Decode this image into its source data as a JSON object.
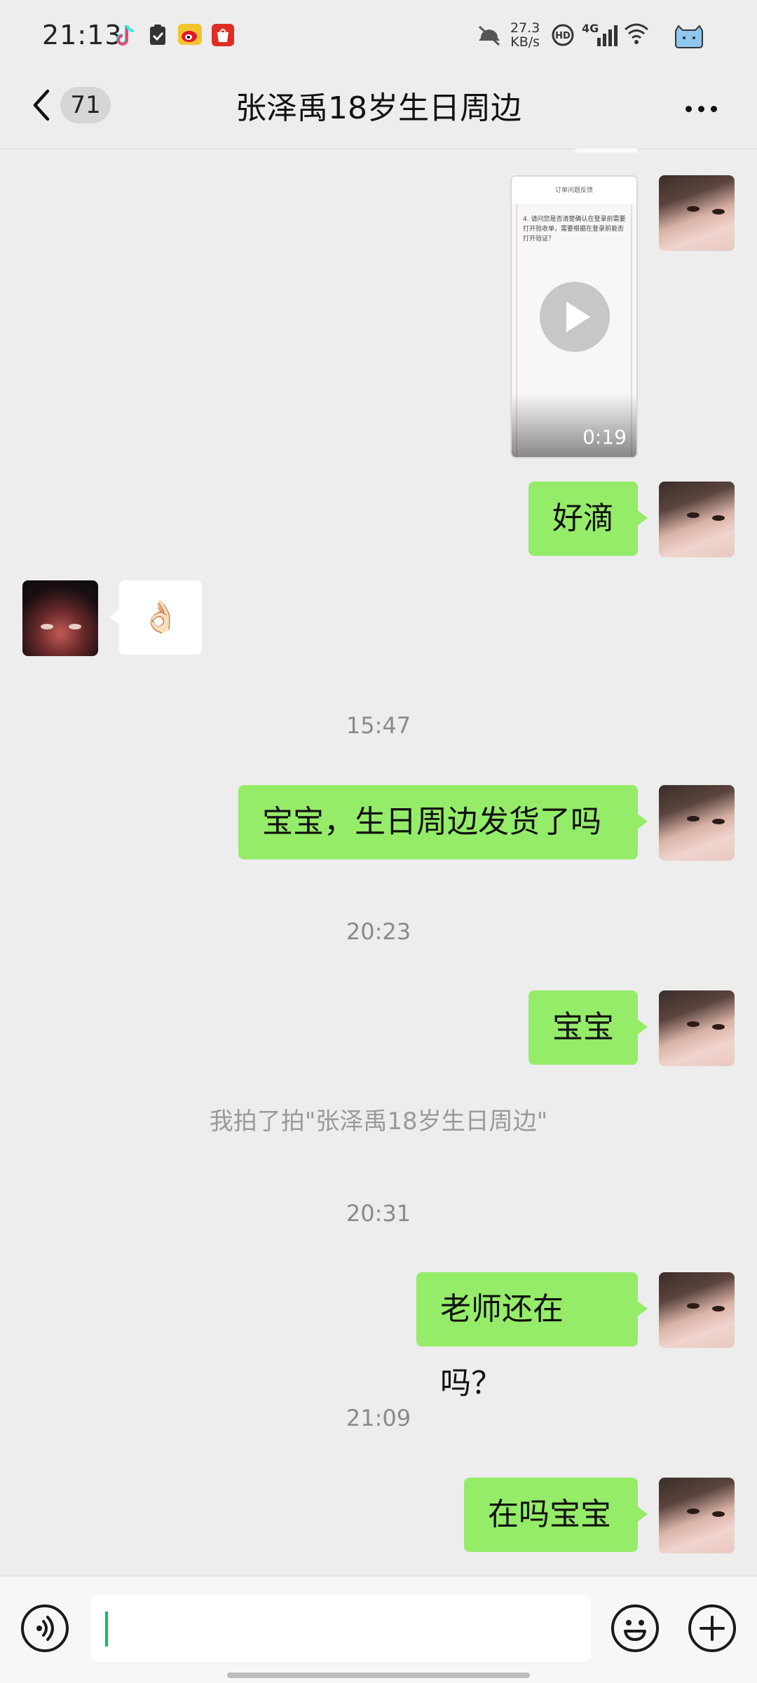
{
  "status_bar": {
    "time": "21:13",
    "net_speed_value": "27.3",
    "net_speed_unit": "KB/s",
    "hd_label": "HD",
    "network": "4G",
    "icons": [
      "tiktok-icon",
      "task-check-icon",
      "weibo-icon",
      "shopping-app-icon",
      "mute-icon",
      "hd-icon",
      "signal-icon",
      "wifi-icon",
      "battery-icon"
    ]
  },
  "header": {
    "unread_count": "71",
    "title": "张泽禹18岁生日周边"
  },
  "messages": {
    "video_duration": "0:19",
    "video_screen_title": "订单问题反馈",
    "video_screen_text": "4. 请问您是否清楚确认在登录前需要打开验收单，需要根据在登录前能否打开验证？",
    "msg_haodi": "好滴",
    "emoji_ok": "👌🏻",
    "ts_1": "15:47",
    "msg_shipping": "宝宝，生日周边发货了吗",
    "ts_2": "20:23",
    "msg_baobao": "宝宝",
    "system_pat": "我拍了拍\"张泽禹18岁生日周边\"",
    "ts_3": "20:31",
    "msg_teacher": "老师还在吗？",
    "ts_4": "21:09",
    "msg_zaima": "在吗宝宝"
  },
  "colors": {
    "background": "#ededed",
    "bubble_green": "#95ec69",
    "bubble_white": "#ffffff",
    "caret_green": "#07c160"
  }
}
